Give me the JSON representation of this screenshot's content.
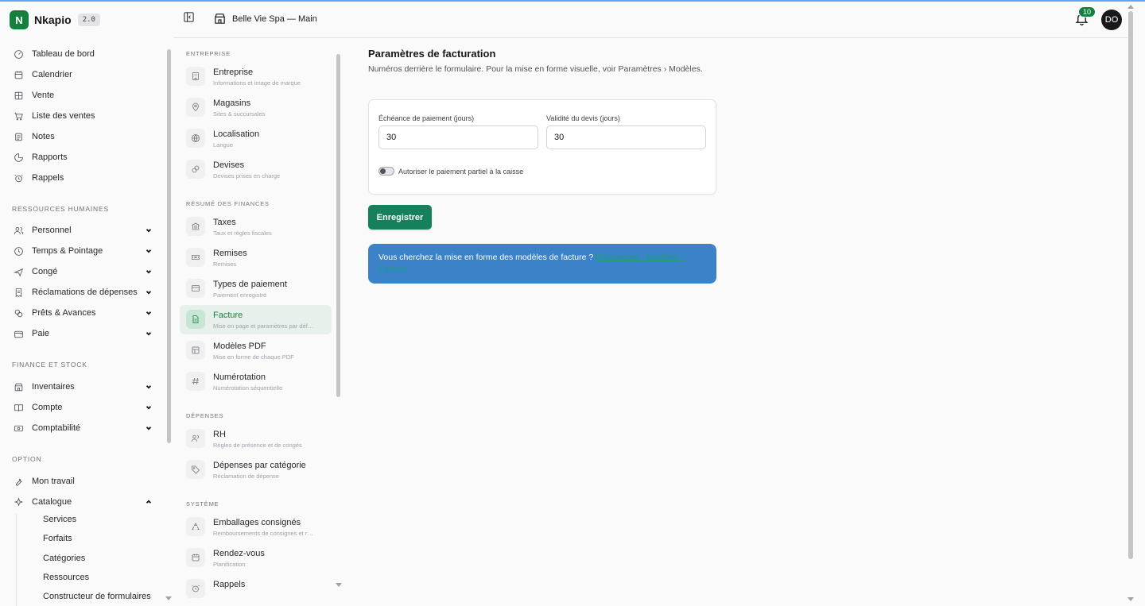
{
  "brand": {
    "name": "Nkapio",
    "version": "2.0",
    "logo_letter": "N",
    "accent": "#15803d"
  },
  "header": {
    "store": "Belle Vie Spa — Main",
    "notifications": "10",
    "avatar": "DO"
  },
  "sidebar": {
    "main_items": [
      {
        "label": "Tableau de bord",
        "icon": "dashboard-icon"
      },
      {
        "label": "Calendrier",
        "icon": "calendar-icon"
      },
      {
        "label": "Vente",
        "icon": "grid-icon"
      },
      {
        "label": "Liste des ventes",
        "icon": "cart-icon"
      },
      {
        "label": "Notes",
        "icon": "notes-icon"
      },
      {
        "label": "Rapports",
        "icon": "pie-chart-icon"
      },
      {
        "label": "Rappels",
        "icon": "alarm-icon"
      }
    ],
    "hr_section": "RESSOURCES HUMAINES",
    "hr_items": [
      {
        "label": "Personnel",
        "icon": "users-icon"
      },
      {
        "label": "Temps & Pointage",
        "icon": "clock-icon"
      },
      {
        "label": "Congé",
        "icon": "plane-icon"
      },
      {
        "label": "Réclamations de dépenses",
        "icon": "receipt-icon"
      },
      {
        "label": "Prêts & Avances",
        "icon": "coins-icon"
      },
      {
        "label": "Paie",
        "icon": "wallet-icon"
      }
    ],
    "finance_section": "FINANCE ET STOCK",
    "finance_items": [
      {
        "label": "Inventaires",
        "icon": "store-icon"
      },
      {
        "label": "Compte",
        "icon": "book-icon"
      },
      {
        "label": "Comptabilité",
        "icon": "banknote-icon"
      }
    ],
    "option_section": "OPTION",
    "option_items": [
      {
        "label": "Mon travail",
        "icon": "wrench-icon"
      },
      {
        "label": "Catalogue",
        "icon": "sparkles-icon"
      }
    ],
    "catalogue_sub": [
      "Services",
      "Forfaits",
      "Catégories",
      "Ressources",
      "Constructeur de formulaires"
    ]
  },
  "settings_nav": {
    "section_entreprise": "ENTREPRISE",
    "section_finances": "RÉSUMÉ DES FINANCES",
    "section_depenses": "DÉPENSES",
    "section_systeme": "SYSTÈME",
    "items": [
      {
        "label": "Entreprise",
        "desc": "Informations et image de marque",
        "icon": "building-icon"
      },
      {
        "label": "Magasins",
        "desc": "Sites & succursales",
        "icon": "map-pin-icon"
      },
      {
        "label": "Localisation",
        "desc": "Langue",
        "icon": "globe-icon"
      },
      {
        "label": "Devises",
        "desc": "Devises prises en charge",
        "icon": "currency-icon"
      },
      {
        "label": "Taxes",
        "desc": "Taux et règles fiscales",
        "icon": "landmark-icon"
      },
      {
        "label": "Remises",
        "desc": "Remises",
        "icon": "ticket-icon"
      },
      {
        "label": "Types de paiement",
        "desc": "Paiement enregistré",
        "icon": "credit-card-icon"
      },
      {
        "label": "Facture",
        "desc": "Mise en page et paramètres par déf…",
        "icon": "file-text-icon"
      },
      {
        "label": "Modèles PDF",
        "desc": "Mise en forme de chaque PDF",
        "icon": "layout-icon"
      },
      {
        "label": "Numérotation",
        "desc": "Numérotation séquentielle",
        "icon": "hash-icon"
      },
      {
        "label": "RH",
        "desc": "Règles de présence et de congés",
        "icon": "users-icon"
      },
      {
        "label": "Dépenses par catégorie",
        "desc": "Réclamation de dépense",
        "icon": "tag-icon"
      },
      {
        "label": "Emballages consignés",
        "desc": "Remboursements de consignes et r…",
        "icon": "recycle-icon"
      },
      {
        "label": "Rendez-vous",
        "desc": "Planification",
        "icon": "calendar-icon"
      },
      {
        "label": "Rappels",
        "desc": "",
        "icon": "alarm-icon"
      }
    ]
  },
  "main": {
    "title": "Paramètres de facturation",
    "subtitle": "Numéros derrière le formulaire. Pour la mise en forme visuelle, voir Paramètres › Modèles.",
    "payment_due_label": "Échéance de paiement (jours)",
    "payment_due_value": "30",
    "quote_validity_label": "Validité du devis (jours)",
    "quote_validity_value": "30",
    "partial_payment_label": "Autoriser le paiement partiel à la caisse",
    "save_label": "Enregistrer",
    "info_text": "Vous cherchez la mise en forme des modèles de facture ? ",
    "info_link": "Paramètres › Modèles › Facture"
  }
}
